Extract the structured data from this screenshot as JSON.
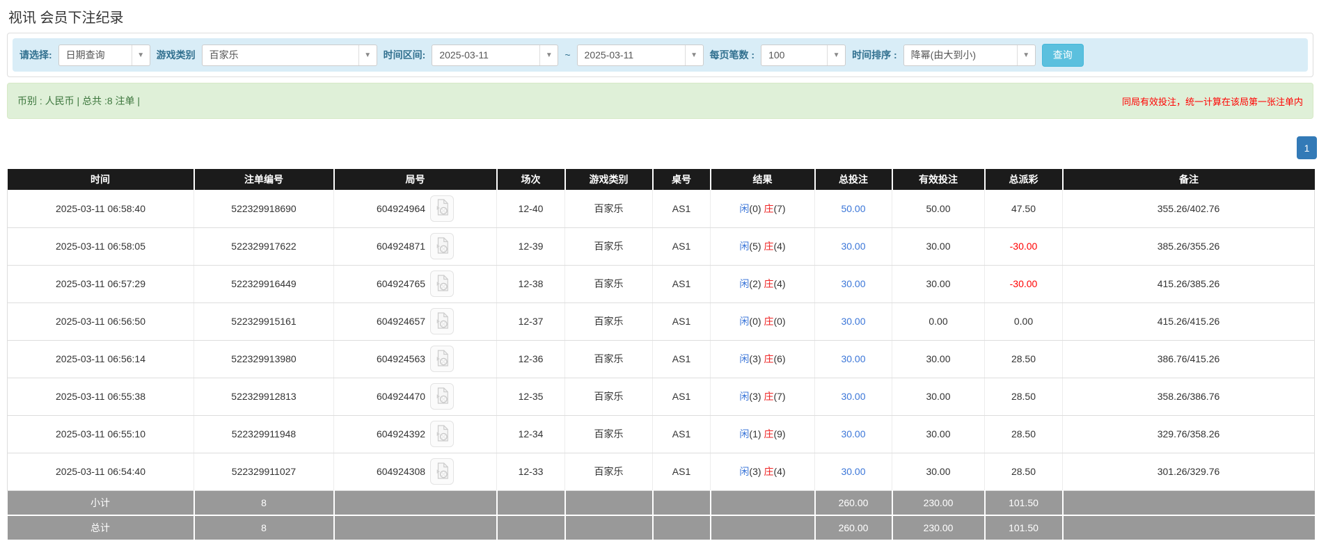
{
  "page": {
    "title": "视讯 会员下注纪录"
  },
  "filters": {
    "select_label": "请选择:",
    "select_value": "日期查询",
    "game_type_label": "游戏类别",
    "game_type_value": "百家乐",
    "time_range_label": "时间区间:",
    "time_from": "2025-03-11",
    "range_separator": "~",
    "time_to": "2025-03-11",
    "page_size_label": "每页笔数 :",
    "page_size_value": "100",
    "sort_label": "时间排序 :",
    "sort_value": "降幂(由大到小)",
    "search_button": "查询",
    "caret_glyph": "▼"
  },
  "summary": {
    "left_text": "币别 : 人民币 | 总共 :8 注单 |",
    "right_note": "同局有效投注，统一计算在该局第一张注单内"
  },
  "pagination": {
    "current_page": "1"
  },
  "colors": {
    "header_bg": "#1b1b1b",
    "filter_bar_bg": "#d9edf7",
    "summary_bg": "#dff0d8",
    "search_button_bg": "#5bc0de",
    "pager_active_bg": "#337ab7",
    "player_blue": "#3b76d8",
    "banker_red": "#e22222",
    "negative_red": "#ff0000",
    "total_row_bg": "#999999"
  },
  "table": {
    "headers": [
      "时间",
      "注单编号",
      "局号",
      "场次",
      "游戏类别",
      "桌号",
      "结果",
      "总投注",
      "有效投注",
      "总派彩",
      "备注"
    ],
    "rows": [
      {
        "time": "2025-03-11 06:58:40",
        "bet_id": "522329918690",
        "round_id": "604924964",
        "session": "12-40",
        "game": "百家乐",
        "table_no": "AS1",
        "player_label": "闲",
        "player_score": "(0)",
        "banker_label": "庄",
        "banker_score": "(7)",
        "total_bet": "50.00",
        "valid_bet": "50.00",
        "payout": "47.50",
        "payout_negative": false,
        "remark": "355.26/402.76"
      },
      {
        "time": "2025-03-11 06:58:05",
        "bet_id": "522329917622",
        "round_id": "604924871",
        "session": "12-39",
        "game": "百家乐",
        "table_no": "AS1",
        "player_label": "闲",
        "player_score": "(5)",
        "banker_label": "庄",
        "banker_score": "(4)",
        "total_bet": "30.00",
        "valid_bet": "30.00",
        "payout": "-30.00",
        "payout_negative": true,
        "remark": "385.26/355.26"
      },
      {
        "time": "2025-03-11 06:57:29",
        "bet_id": "522329916449",
        "round_id": "604924765",
        "session": "12-38",
        "game": "百家乐",
        "table_no": "AS1",
        "player_label": "闲",
        "player_score": "(2)",
        "banker_label": "庄",
        "banker_score": "(4)",
        "total_bet": "30.00",
        "valid_bet": "30.00",
        "payout": "-30.00",
        "payout_negative": true,
        "remark": "415.26/385.26"
      },
      {
        "time": "2025-03-11 06:56:50",
        "bet_id": "522329915161",
        "round_id": "604924657",
        "session": "12-37",
        "game": "百家乐",
        "table_no": "AS1",
        "player_label": "闲",
        "player_score": "(0)",
        "banker_label": "庄",
        "banker_score": "(0)",
        "total_bet": "30.00",
        "valid_bet": "0.00",
        "payout": "0.00",
        "payout_negative": false,
        "remark": "415.26/415.26"
      },
      {
        "time": "2025-03-11 06:56:14",
        "bet_id": "522329913980",
        "round_id": "604924563",
        "session": "12-36",
        "game": "百家乐",
        "table_no": "AS1",
        "player_label": "闲",
        "player_score": "(3)",
        "banker_label": "庄",
        "banker_score": "(6)",
        "total_bet": "30.00",
        "valid_bet": "30.00",
        "payout": "28.50",
        "payout_negative": false,
        "remark": "386.76/415.26"
      },
      {
        "time": "2025-03-11 06:55:38",
        "bet_id": "522329912813",
        "round_id": "604924470",
        "session": "12-35",
        "game": "百家乐",
        "table_no": "AS1",
        "player_label": "闲",
        "player_score": "(3)",
        "banker_label": "庄",
        "banker_score": "(7)",
        "total_bet": "30.00",
        "valid_bet": "30.00",
        "payout": "28.50",
        "payout_negative": false,
        "remark": "358.26/386.76"
      },
      {
        "time": "2025-03-11 06:55:10",
        "bet_id": "522329911948",
        "round_id": "604924392",
        "session": "12-34",
        "game": "百家乐",
        "table_no": "AS1",
        "player_label": "闲",
        "player_score": "(1)",
        "banker_label": "庄",
        "banker_score": "(9)",
        "total_bet": "30.00",
        "valid_bet": "30.00",
        "payout": "28.50",
        "payout_negative": false,
        "remark": "329.76/358.26"
      },
      {
        "time": "2025-03-11 06:54:40",
        "bet_id": "522329911027",
        "round_id": "604924308",
        "session": "12-33",
        "game": "百家乐",
        "table_no": "AS1",
        "player_label": "闲",
        "player_score": "(3)",
        "banker_label": "庄",
        "banker_score": "(4)",
        "total_bet": "30.00",
        "valid_bet": "30.00",
        "payout": "28.50",
        "payout_negative": false,
        "remark": "301.26/329.76"
      }
    ],
    "subtotal": {
      "label": "小计",
      "count": "8",
      "total_bet": "260.00",
      "valid_bet": "230.00",
      "payout": "101.50"
    },
    "total": {
      "label": "总计",
      "count": "8",
      "total_bet": "260.00",
      "valid_bet": "230.00",
      "payout": "101.50"
    }
  }
}
